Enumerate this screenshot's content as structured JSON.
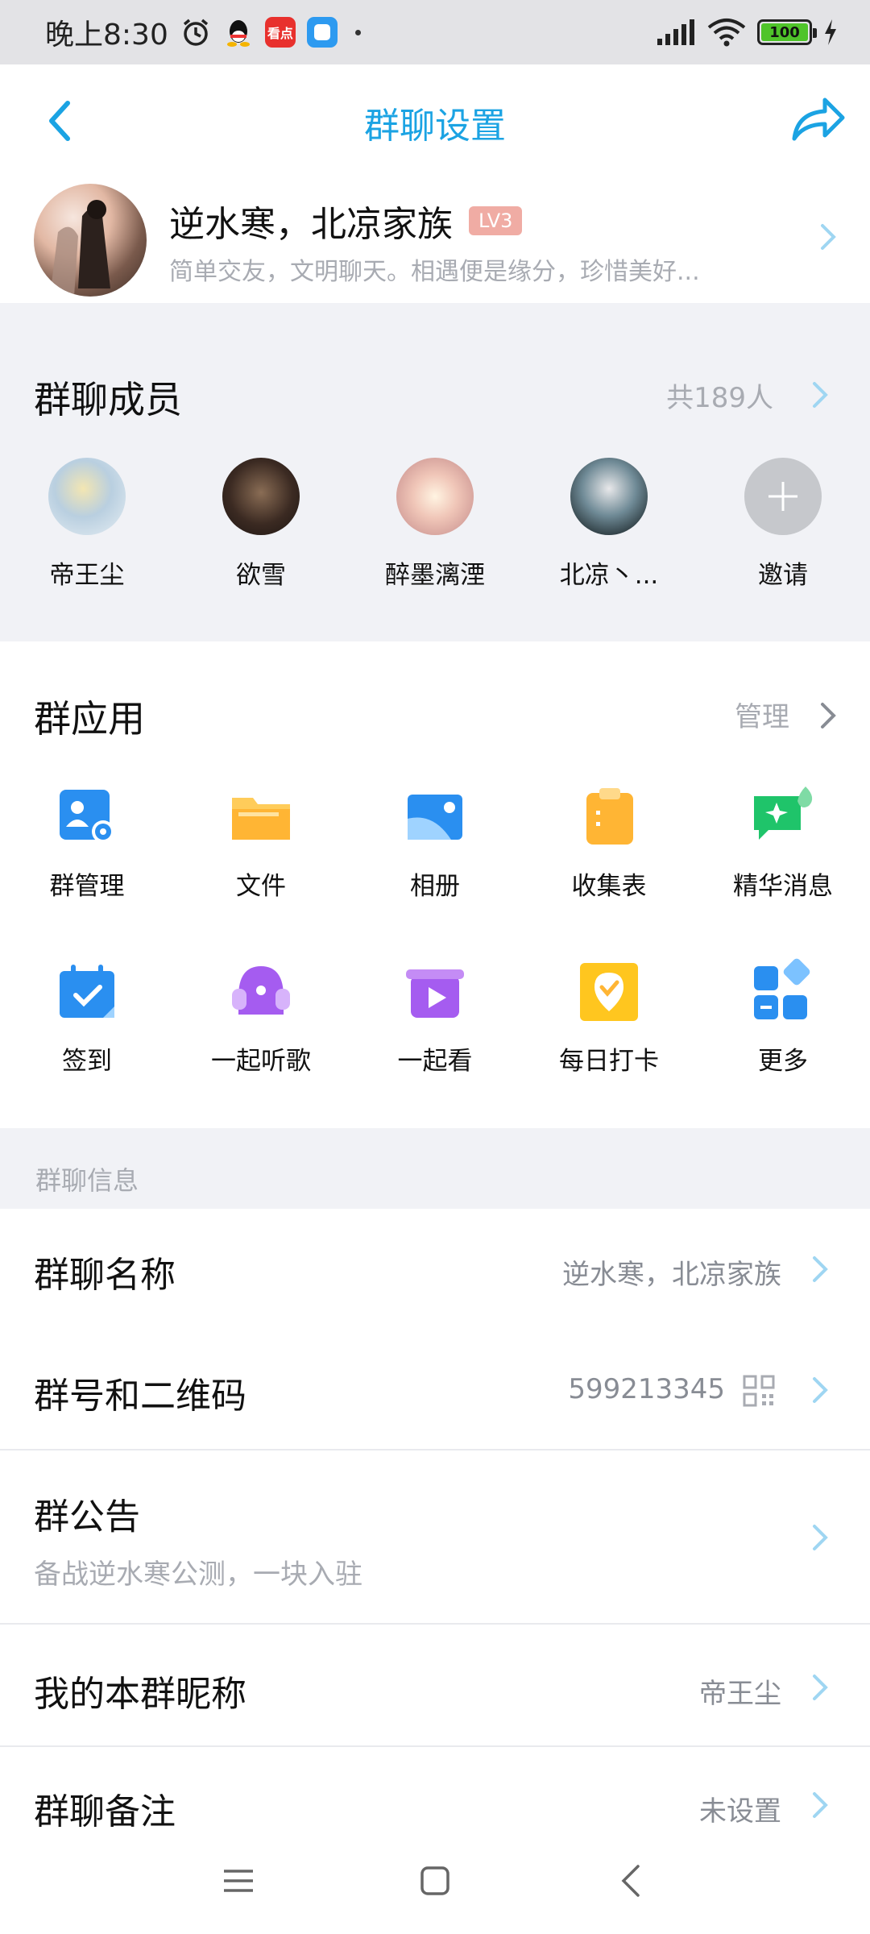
{
  "status_bar": {
    "time": "晚上8:30",
    "battery": "100",
    "app_news_label": "看点"
  },
  "header": {
    "title": "群聊设置"
  },
  "group": {
    "name": "逆水寒，北凉家族",
    "level": "LV3",
    "description": "简单交友，文明聊天。相遇便是缘分，珍惜美好..."
  },
  "members": {
    "title": "群聊成员",
    "count": "共189人",
    "list": [
      {
        "name": "帝王尘"
      },
      {
        "name": "欲雪"
      },
      {
        "name": "醉墨漓湮"
      },
      {
        "name": "北凉丶..."
      },
      {
        "name": "邀请"
      }
    ]
  },
  "apps": {
    "title": "群应用",
    "manage": "管理",
    "items": [
      {
        "label": "群管理",
        "icon": "group-admin-icon",
        "color": "#2a8ff0"
      },
      {
        "label": "文件",
        "icon": "folder-icon",
        "color": "#ffb534"
      },
      {
        "label": "相册",
        "icon": "album-icon",
        "color": "#2a8ff0"
      },
      {
        "label": "收集表",
        "icon": "clipboard-icon",
        "color": "#ffb534"
      },
      {
        "label": "精华消息",
        "icon": "essence-message-icon",
        "color": "#1fc46a"
      },
      {
        "label": "签到",
        "icon": "calendar-check-icon",
        "color": "#2a8ff0"
      },
      {
        "label": "一起听歌",
        "icon": "headphones-icon",
        "color": "#a55cf0"
      },
      {
        "label": "一起看",
        "icon": "play-box-icon",
        "color": "#a55cf0"
      },
      {
        "label": "每日打卡",
        "icon": "check-badge-icon",
        "color": "#ffb534"
      },
      {
        "label": "更多",
        "icon": "more-grid-icon",
        "color": "#2a8ff0"
      }
    ]
  },
  "info": {
    "section_label": "群聊信息",
    "group_name": {
      "label": "群聊名称",
      "value": "逆水寒，北凉家族"
    },
    "group_id": {
      "label": "群号和二维码",
      "value": "599213345"
    },
    "notice": {
      "label": "群公告",
      "value": "备战逆水寒公测，一块入驻"
    },
    "my_nickname": {
      "label": "我的本群昵称",
      "value": "帝王尘"
    },
    "remark": {
      "label": "群聊备注",
      "value": "未设置"
    }
  },
  "colors": {
    "accent": "#1ba3e3",
    "chevron": "#9fd6f2",
    "muted": "#a8abb2"
  }
}
